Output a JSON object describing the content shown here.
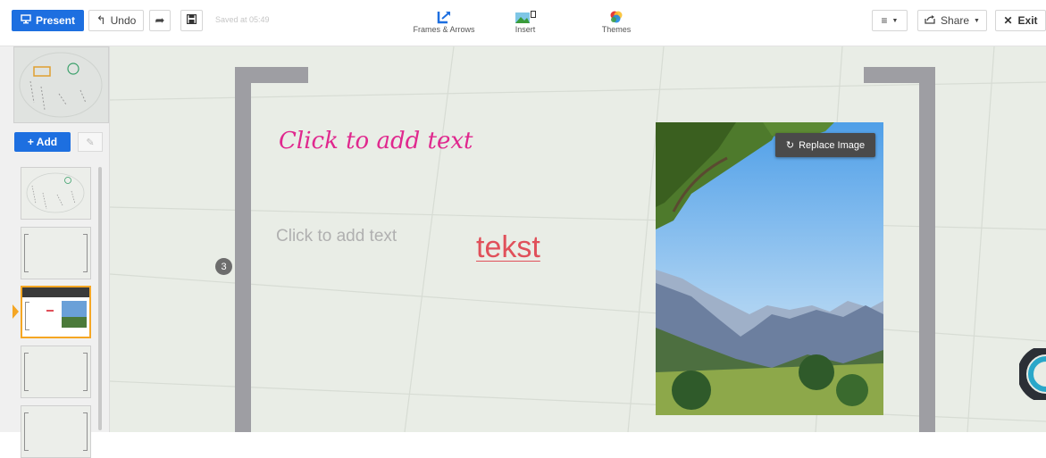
{
  "toolbar": {
    "present_label": "Present",
    "undo_label": "Undo",
    "saved_status": "Saved at 05:49",
    "frames_label": "Frames & Arrows",
    "insert_label": "Insert",
    "themes_label": "Themes",
    "share_label": "Share",
    "exit_label": "Exit",
    "icons": {
      "present": "monitor-icon",
      "undo": "undo-arrow-icon",
      "redo": "redo-arrow-icon",
      "save": "floppy-disk-icon",
      "frames": "frames-arrows-icon",
      "insert": "insert-image-icon",
      "themes": "themes-palette-icon",
      "menu": "hamburger-menu-icon",
      "share": "share-icon",
      "exit": "close-icon"
    }
  },
  "sidebar": {
    "add_label": "+ Add",
    "path_step_number": "3",
    "active_thumbnail_number": 3
  },
  "canvas": {
    "title_placeholder": "Click to add text",
    "body_placeholder": "Click to add text",
    "body_text": "tekst",
    "replace_image_label": "Replace Image"
  },
  "colors": {
    "accent_blue": "#1d6fe0",
    "title_pink": "#e0288e",
    "tekst_red": "#e0505a",
    "active_orange": "#f5a623",
    "frame_gray": "#9e9ea3",
    "canvas_bg": "#e9ede6"
  }
}
